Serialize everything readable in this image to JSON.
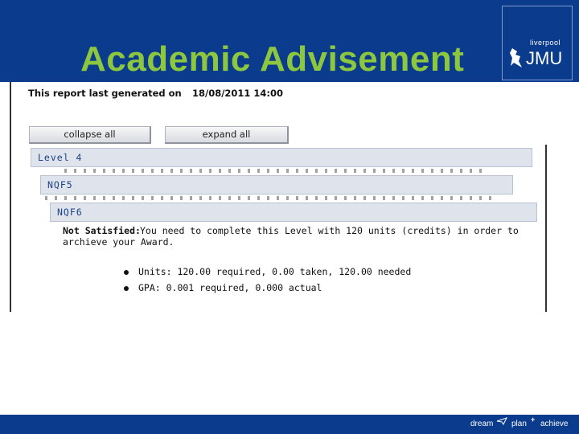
{
  "slide": {
    "title": "Academic Advisement",
    "logo": {
      "small_text": "liverpool",
      "big_text": "JMU"
    }
  },
  "report": {
    "generated_label": "This report last generated on",
    "generated_value": "18/08/2011 14:00"
  },
  "buttons": {
    "collapse_all": "collapse all",
    "expand_all": "expand all"
  },
  "sections": {
    "level4": "Level 4",
    "nqf5": "NQF5",
    "nqf6": "NQF6"
  },
  "status": {
    "label": "Not Satisfied:",
    "message": "You need to complete this Level with 120 units (credits) in order to archieve your Award."
  },
  "requirements": [
    "Units: 120.00 required, 0.00 taken, 120.00 needed",
    "GPA: 0.001 required, 0.000 actual"
  ],
  "footer": {
    "words": [
      "dream",
      "plan",
      "achieve"
    ]
  },
  "colors": {
    "header_band": "#0a3b8c",
    "title_green": "#8dc63f",
    "section_bar": "#dfe4ec",
    "section_text": "#1c3f86"
  }
}
